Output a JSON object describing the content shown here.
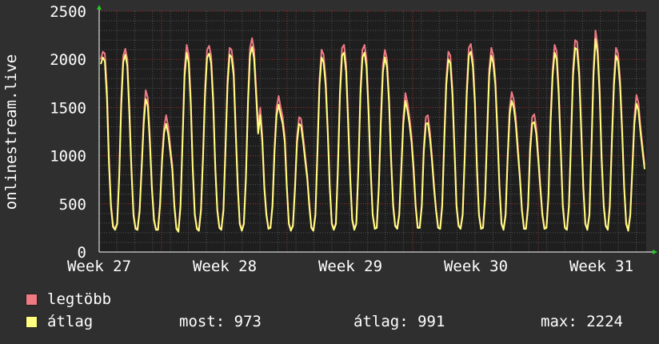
{
  "chart_data": {
    "type": "line",
    "ylabel": "onlinestream.live",
    "ylim": [
      0,
      2500
    ],
    "yticks": [
      0,
      500,
      1000,
      1500,
      2000,
      2500
    ],
    "grid": true,
    "xticks": [
      "Week 27",
      "Week 28",
      "Week 29",
      "Week 30",
      "Week 31"
    ],
    "series": [
      {
        "name": "legtöbb",
        "color": "#f07a84",
        "values": [
          2000,
          2080,
          2060,
          1700,
          1000,
          500,
          280,
          240,
          300,
          800,
          1600,
          2040,
          2110,
          2000,
          1500,
          900,
          400,
          250,
          240,
          450,
          900,
          1400,
          1680,
          1600,
          1200,
          700,
          350,
          240,
          240,
          500,
          1000,
          1300,
          1420,
          1300,
          1100,
          900,
          500,
          250,
          220,
          500,
          1200,
          1900,
          2150,
          2050,
          1600,
          900,
          400,
          250,
          230,
          450,
          1000,
          1700,
          2100,
          2140,
          2040,
          1600,
          900,
          450,
          260,
          240,
          450,
          1100,
          1800,
          2120,
          2100,
          1900,
          1300,
          700,
          300,
          230,
          300,
          800,
          1600,
          2120,
          2220,
          2100,
          1700,
          1300,
          1500,
          1200,
          700,
          400,
          250,
          260,
          500,
          1100,
          1500,
          1620,
          1500,
          1400,
          1200,
          700,
          300,
          230,
          280,
          700,
          1200,
          1400,
          1380,
          1200,
          1000,
          800,
          500,
          260,
          230,
          400,
          1100,
          1800,
          2100,
          2050,
          1800,
          1300,
          700,
          300,
          240,
          300,
          900,
          1700,
          2120,
          2150,
          1950,
          1400,
          800,
          350,
          240,
          300,
          900,
          1700,
          2100,
          2150,
          2000,
          1500,
          900,
          400,
          250,
          260,
          700,
          1400,
          1950,
          2100,
          2000,
          1600,
          1000,
          500,
          280,
          250,
          400,
          900,
          1400,
          1650,
          1550,
          1400,
          1200,
          900,
          500,
          260,
          260,
          500,
          1100,
          1400,
          1420,
          1250,
          1000,
          700,
          450,
          260,
          250,
          500,
          1200,
          1800,
          2080,
          2040,
          1700,
          1100,
          500,
          280,
          250,
          400,
          1000,
          1700,
          2120,
          2160,
          2000,
          1600,
          900,
          400,
          250,
          260,
          600,
          1300,
          1900,
          2120,
          2040,
          1800,
          1300,
          700,
          300,
          240,
          400,
          1000,
          1500,
          1660,
          1580,
          1400,
          1100,
          800,
          450,
          250,
          250,
          500,
          1100,
          1400,
          1430,
          1300,
          1000,
          700,
          400,
          250,
          260,
          600,
          1400,
          1900,
          2150,
          2080,
          1700,
          1100,
          500,
          260,
          240,
          500,
          1200,
          1900,
          2200,
          2180,
          1900,
          1300,
          700,
          300,
          240,
          400,
          1100,
          1900,
          2300,
          2150,
          1700,
          1000,
          500,
          280,
          240,
          500,
          1200,
          1800,
          2120,
          2060,
          1800,
          1300,
          700,
          300,
          230,
          400,
          900,
          1400,
          1630,
          1550,
          1300,
          1100,
          900
        ]
      },
      {
        "name": "átlag",
        "color": "#ffff80",
        "values": [
          1950,
          2020,
          1980,
          1600,
          920,
          460,
          260,
          230,
          290,
          760,
          1520,
          1970,
          2050,
          1930,
          1420,
          850,
          380,
          240,
          230,
          420,
          860,
          1330,
          1590,
          1520,
          1130,
          660,
          330,
          230,
          230,
          480,
          950,
          1240,
          1330,
          1220,
          1040,
          850,
          470,
          240,
          210,
          470,
          1150,
          1830,
          2070,
          1970,
          1540,
          850,
          380,
          240,
          220,
          430,
          960,
          1630,
          2020,
          2060,
          1960,
          1540,
          860,
          430,
          250,
          230,
          430,
          1050,
          1730,
          2050,
          2020,
          1830,
          1240,
          670,
          290,
          220,
          290,
          760,
          1540,
          2040,
          2130,
          2010,
          1620,
          1230,
          1420,
          1140,
          660,
          380,
          240,
          250,
          470,
          1040,
          1420,
          1530,
          1420,
          1330,
          1140,
          670,
          290,
          220,
          270,
          660,
          1140,
          1330,
          1310,
          1140,
          950,
          760,
          470,
          250,
          220,
          380,
          1050,
          1730,
          2020,
          1970,
          1730,
          1240,
          670,
          290,
          230,
          290,
          850,
          1630,
          2040,
          2070,
          1870,
          1330,
          760,
          330,
          230,
          290,
          850,
          1630,
          2020,
          2070,
          1920,
          1430,
          850,
          380,
          240,
          250,
          670,
          1330,
          1870,
          2020,
          1920,
          1540,
          950,
          470,
          270,
          240,
          380,
          850,
          1330,
          1570,
          1470,
          1330,
          1140,
          850,
          470,
          250,
          250,
          470,
          1040,
          1330,
          1340,
          1180,
          950,
          660,
          430,
          250,
          240,
          470,
          1140,
          1730,
          2000,
          1960,
          1630,
          1050,
          470,
          270,
          240,
          380,
          950,
          1630,
          2040,
          2080,
          1920,
          1540,
          850,
          380,
          240,
          250,
          570,
          1240,
          1830,
          2040,
          1960,
          1730,
          1240,
          670,
          290,
          230,
          380,
          950,
          1430,
          1570,
          1500,
          1330,
          1040,
          760,
          430,
          240,
          240,
          470,
          1040,
          1330,
          1350,
          1230,
          950,
          660,
          380,
          240,
          250,
          570,
          1330,
          1830,
          2070,
          2000,
          1630,
          1050,
          470,
          250,
          230,
          470,
          1140,
          1830,
          2120,
          2100,
          1830,
          1240,
          670,
          290,
          230,
          380,
          1050,
          1830,
          2210,
          2070,
          1630,
          950,
          470,
          270,
          230,
          470,
          1140,
          1730,
          2040,
          1980,
          1730,
          1240,
          670,
          290,
          220,
          380,
          850,
          1330,
          1540,
          1470,
          1240,
          1050,
          860
        ]
      }
    ]
  },
  "legend": [
    {
      "label": "legtöbb",
      "color": "#f07a84"
    },
    {
      "label": "átlag",
      "color": "#ffff80"
    }
  ],
  "stats": {
    "most": "most: 973",
    "atlag": "átlag: 991",
    "max": "max: 2224"
  },
  "colors": {
    "background": "#2f2f2f",
    "plot_background": "#1e1e1e",
    "major_grid": "#a03030",
    "minor_grid": "#555555",
    "axis": "#ffffff",
    "arrow": "#22cc22"
  }
}
